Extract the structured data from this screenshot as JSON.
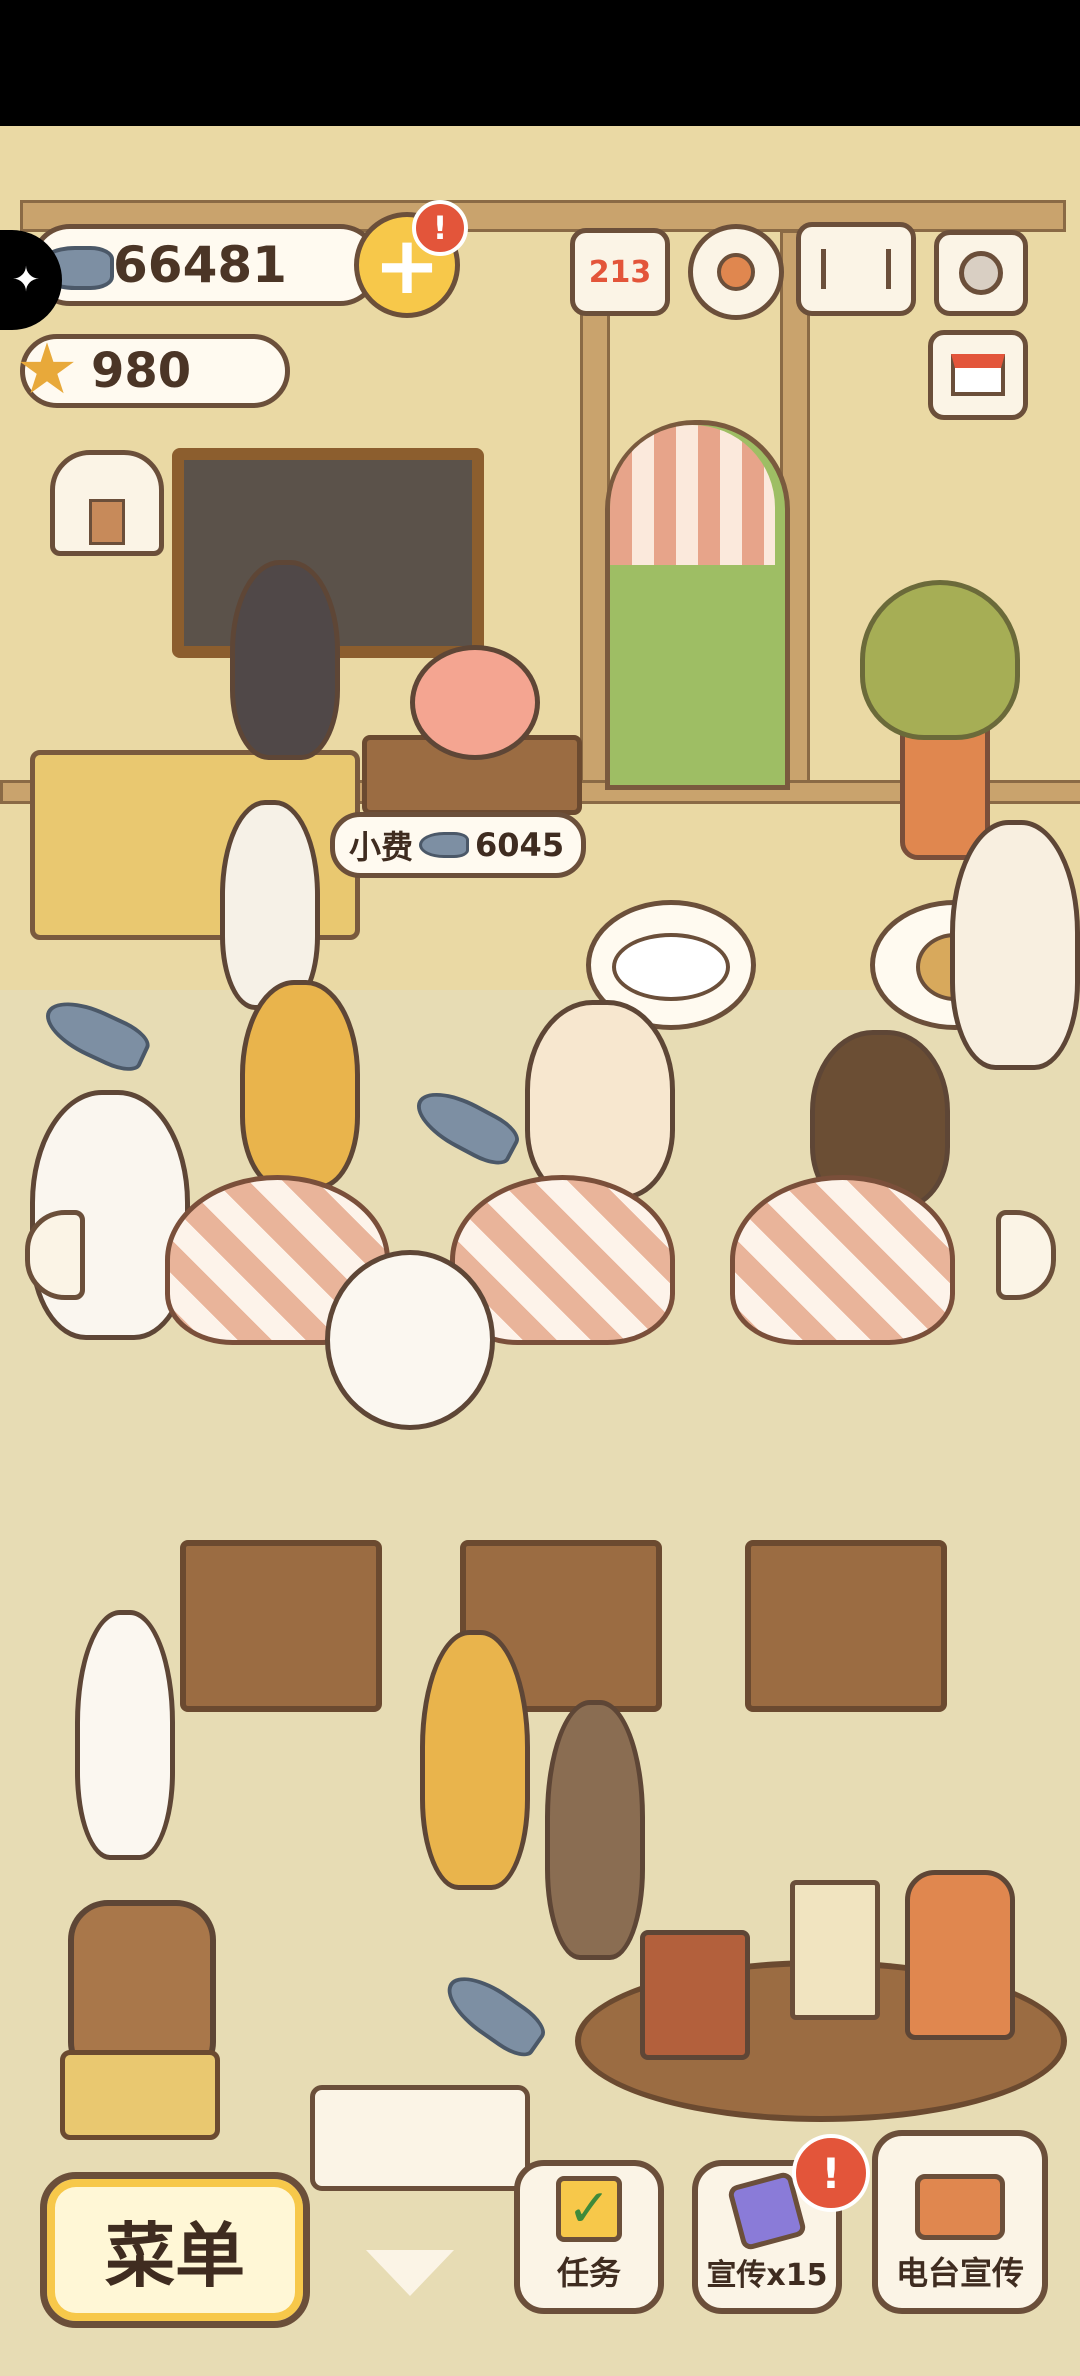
{
  "currency": {
    "fish_count": "66481",
    "star_count": "980"
  },
  "tip_bubble": {
    "label": "小费",
    "amount": "6045"
  },
  "top_icons": {
    "ranking_digits": "213"
  },
  "bottom_bar": {
    "menu_label": "菜单",
    "tasks_label": "任务",
    "promote_label": "宣传x15",
    "radio_label": "电台宣传"
  },
  "alerts": {
    "badge": "!"
  },
  "colors": {
    "accent_yellow": "#f7c84a",
    "alert_red": "#e3553a",
    "outline_brown": "#6b4f3a"
  }
}
